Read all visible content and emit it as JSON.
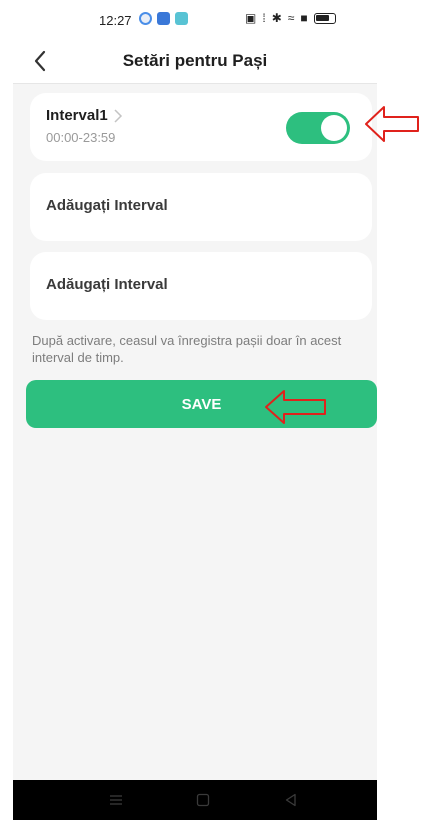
{
  "status_bar": {
    "time": "12:27",
    "icons": [
      "weather-app-icon",
      "maps-app-icon",
      "gallery-app-icon",
      "nfc-icon",
      "vibrate-icon",
      "bluetooth-icon",
      "wifi-icon",
      "sim-icon",
      "battery-icon"
    ]
  },
  "header": {
    "title": "Setări pentru Pași",
    "back_icon": "chevron-left-icon"
  },
  "intervals": [
    {
      "name": "Interval1",
      "time": "00:00-23:59",
      "enabled": true
    }
  ],
  "add_interval_labels": [
    "Adăugați Interval",
    "Adăugați Interval"
  ],
  "note": "După activare, ceasul va înregistra pașii doar în acest interval de timp.",
  "save_label": "SAVE",
  "nav_bar": {
    "buttons": [
      "menu-icon",
      "home-icon",
      "back-triangle-icon"
    ]
  },
  "colors": {
    "accent": "#2dbf7f",
    "annotation": "#e0221c",
    "background": "#f5f5f5"
  }
}
